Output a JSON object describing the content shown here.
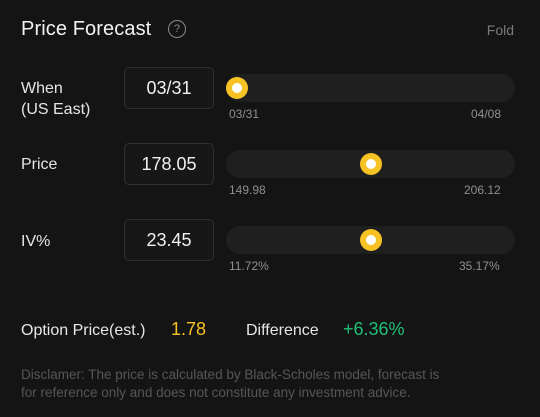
{
  "header": {
    "title": "Price Forecast",
    "help_icon": "question-circle-icon",
    "fold_label": "Fold"
  },
  "rows": {
    "when": {
      "label_line1": "When",
      "label_line2": "(US East)",
      "value": "03/31",
      "slider_min": "03/31",
      "slider_max": "04/08",
      "slider_fraction": 0.0
    },
    "price": {
      "label": "Price",
      "value": "178.05",
      "slider_min": "149.98",
      "slider_max": "206.12",
      "slider_fraction": 0.5
    },
    "iv": {
      "label": "IV%",
      "value": "23.45",
      "slider_min": "11.72%",
      "slider_max": "35.17%",
      "slider_fraction": 0.5
    }
  },
  "summary": {
    "option_price_label": "Option Price(est.)",
    "option_price_value": "1.78",
    "difference_label": "Difference",
    "difference_value": "+6.36%"
  },
  "disclaimer": "Disclamer: The price is calculated by Black-Scholes model, forecast is for reference only and does not constitute any investment advice.",
  "colors": {
    "accent": "#f7c223",
    "positive": "#1fbf75",
    "background": "#141414"
  }
}
